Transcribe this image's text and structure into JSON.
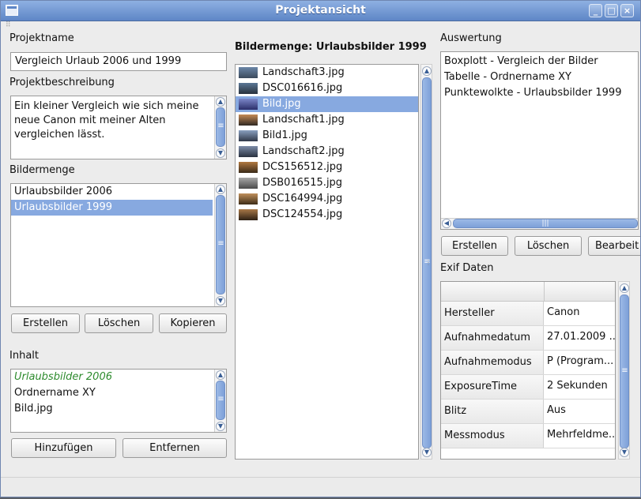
{
  "window": {
    "title": "Projektansicht",
    "grip": "⠿"
  },
  "left": {
    "projektname_label": "Projektname",
    "projektname_value": "Vergleich Urlaub 2006 und 1999",
    "beschreibung_label": "Projektbeschreibung",
    "beschreibung_text": "Ein kleiner Vergleich wie sich meine neue Canon mit meiner Alten vergleichen lässt.",
    "bildermenge_label": "Bildermenge",
    "bildermenge_items": [
      "Urlaubsbilder 2006",
      "Urlaubsbilder 1999"
    ],
    "bildermenge_selected": 1,
    "buttons": {
      "erstellen": "Erstellen",
      "loeschen": "Löschen",
      "kopieren": "Kopieren"
    },
    "inhalt_label": "Inhalt",
    "inhalt_items": [
      "Urlaubsbilder 2006",
      "Ordnername XY",
      "Bild.jpg"
    ],
    "inhalt_buttons": {
      "hinzufuegen": "Hinzufügen",
      "entfernen": "Entfernen"
    }
  },
  "middle": {
    "title": "Bildermenge: Urlaubsbilder 1999",
    "files": [
      "Landschaft3.jpg",
      "DSC016616.jpg",
      "Bild.jpg",
      "Landschaft1.jpg",
      "Bild1.jpg",
      "Landschaft2.jpg",
      "DCS156512.jpg",
      "DSB016515.jpg",
      "DSC164994.jpg",
      "DSC124554.jpg"
    ],
    "selected": 2
  },
  "right": {
    "auswertung_label": "Auswertung",
    "auswertung_items": [
      "Boxplott - Vergleich der Bilder",
      "Tabelle - Ordnername XY",
      "Punktewolkte - Urlaubsbilder 1999"
    ],
    "buttons": {
      "erstellen": "Erstellen",
      "loeschen": "Löschen",
      "bearbeiten": "Bearbeit"
    },
    "exif_label": "Exif Daten",
    "exif_rows": [
      {
        "key": "Hersteller",
        "value": "Canon"
      },
      {
        "key": "Aufnahmedatum",
        "value": "27.01.2009 ..."
      },
      {
        "key": "Aufnahmemodus",
        "value": "P (Program..."
      },
      {
        "key": "ExposureTime",
        "value": "2 Sekunden"
      },
      {
        "key": "Blitz",
        "value": "Aus"
      },
      {
        "key": "Messmodus",
        "value": "Mehrfeldme..."
      }
    ]
  },
  "colors": {
    "accent": "#87a9e0",
    "titlebar": "#6f93cf",
    "inhalt_first_item": "#2e8b2e"
  }
}
